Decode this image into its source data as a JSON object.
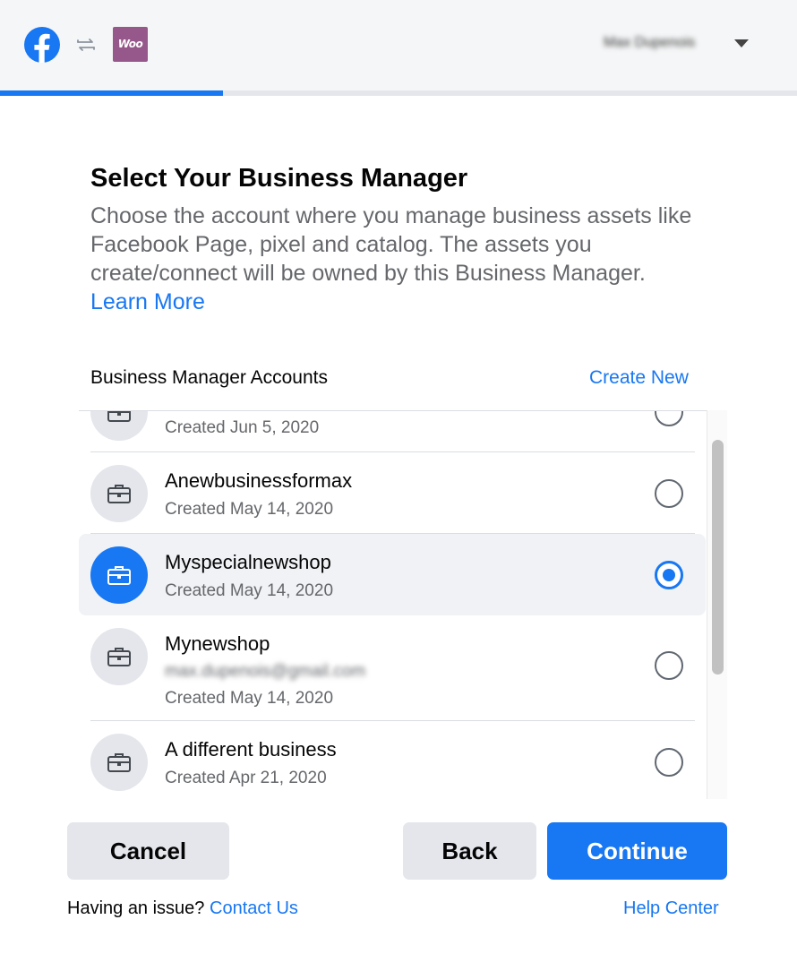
{
  "header": {
    "fb_icon": "facebook-logo",
    "swap_icon": "swap-arrows-icon",
    "woo_badge": "Woo",
    "user_name": "Max Dupenois",
    "progress_percent": 28,
    "accent_color": "#1877f2"
  },
  "main": {
    "title": "Select Your Business Manager",
    "description": "Choose the account where you manage business assets like Facebook Page, pixel and catalog. The assets you create/connect will be owned by this Business Manager.",
    "learn_more": "Learn More",
    "list_heading": "Business Manager Accounts",
    "create_new": "Create New"
  },
  "accounts": [
    {
      "name": "",
      "email": "",
      "created": "Created Jun 5, 2020",
      "selected": false
    },
    {
      "name": "Anewbusinessformax",
      "email": "",
      "created": "Created May 14, 2020",
      "selected": false
    },
    {
      "name": "Myspecialnewshop",
      "email": "",
      "created": "Created May 14, 2020",
      "selected": true
    },
    {
      "name": "Mynewshop",
      "email": "max.dupenois@gmail.com",
      "created": "Created May 14, 2020",
      "selected": false
    },
    {
      "name": "A different business",
      "email": "",
      "created": "Created Apr 21, 2020",
      "selected": false
    }
  ],
  "footer": {
    "cancel": "Cancel",
    "back": "Back",
    "continue": "Continue",
    "issue_text": "Having an issue?",
    "contact_us": "Contact Us",
    "help_center": "Help Center"
  }
}
